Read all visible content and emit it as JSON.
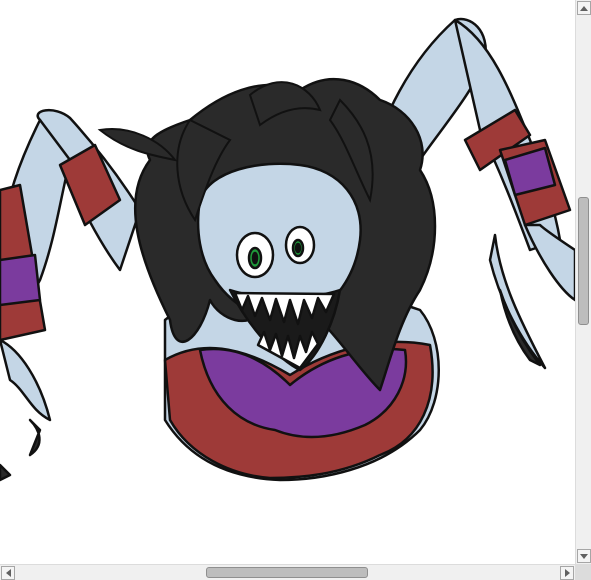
{
  "canvas": {
    "content": "illustration",
    "colors": {
      "skin": "#c4d6e6",
      "hair": "#2a2a2a",
      "top_main": "#7b3b9e",
      "top_trim": "#9e3a38",
      "eyes": "#1f9a3a",
      "outline": "#111111",
      "background": "#ffffff"
    }
  },
  "scrollbars": {
    "vertical": {
      "icons": [
        "scroll-up-arrow-icon",
        "scroll-down-arrow-icon"
      ],
      "position": 0.4
    },
    "horizontal": {
      "icons": [
        "scroll-left-arrow-icon",
        "scroll-right-arrow-icon"
      ],
      "position": 0.45
    }
  }
}
